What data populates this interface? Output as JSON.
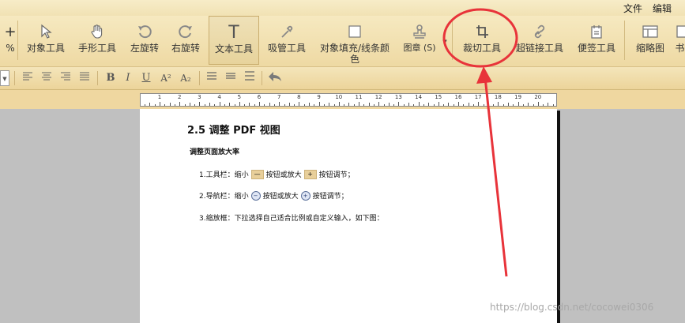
{
  "menu": {
    "file": "文件",
    "edit": "编辑"
  },
  "toolbar": {
    "zoom_plus": "+",
    "zoom_pct": "%",
    "tools": [
      {
        "label": "对象工具",
        "icon": "pointer-icon"
      },
      {
        "label": "手形工具",
        "icon": "hand-icon"
      },
      {
        "label": "左旋转",
        "icon": "rotate-left-icon"
      },
      {
        "label": "右旋转",
        "icon": "rotate-right-icon"
      },
      {
        "label": "文本工具",
        "icon": "text-icon"
      },
      {
        "label": "吸管工具",
        "icon": "eyedropper-icon"
      },
      {
        "label": "对象填充/线条颜色",
        "icon": "fill-icon"
      },
      {
        "label": "图章 (S)",
        "icon": "stamp-icon"
      },
      {
        "label": "裁切工具",
        "icon": "crop-icon"
      },
      {
        "label": "超链接工具",
        "icon": "link-icon"
      },
      {
        "label": "便签工具",
        "icon": "note-icon"
      },
      {
        "label": "缩略图",
        "icon": "thumbnail-icon"
      },
      {
        "label": "书",
        "icon": "bookmark-icon"
      }
    ]
  },
  "format": {
    "bold": "B",
    "italic": "I",
    "underline": "U",
    "superscript": "A²",
    "subscript": "A₂"
  },
  "ruler": {
    "numbers": [
      "1",
      "2",
      "3",
      "4",
      "5",
      "6",
      "7",
      "8",
      "9",
      "10",
      "11",
      "12",
      "13",
      "14",
      "15",
      "16",
      "17",
      "18",
      "19",
      "20"
    ]
  },
  "document": {
    "title": "2.5 调整 PDF 视图",
    "subtitle": "调整页面放大率",
    "line1": {
      "a": "1.工具栏：缩小",
      "b": "按钮或放大",
      "c": "按钮调节；"
    },
    "line2": {
      "a": "2.导航栏：缩小",
      "b": "按钮或放大",
      "c": "按钮调节；"
    },
    "line3": "3.缩放框：下拉选择自己适合比例或自定义输入，如下图："
  },
  "watermark": "https://blog.csdn.net/cocowei0306",
  "colors": {
    "toolbar_bg": "#f1e2b4",
    "annotation": "#e8333a",
    "page": "#ffffff",
    "canvas": "#c0c0c0"
  }
}
